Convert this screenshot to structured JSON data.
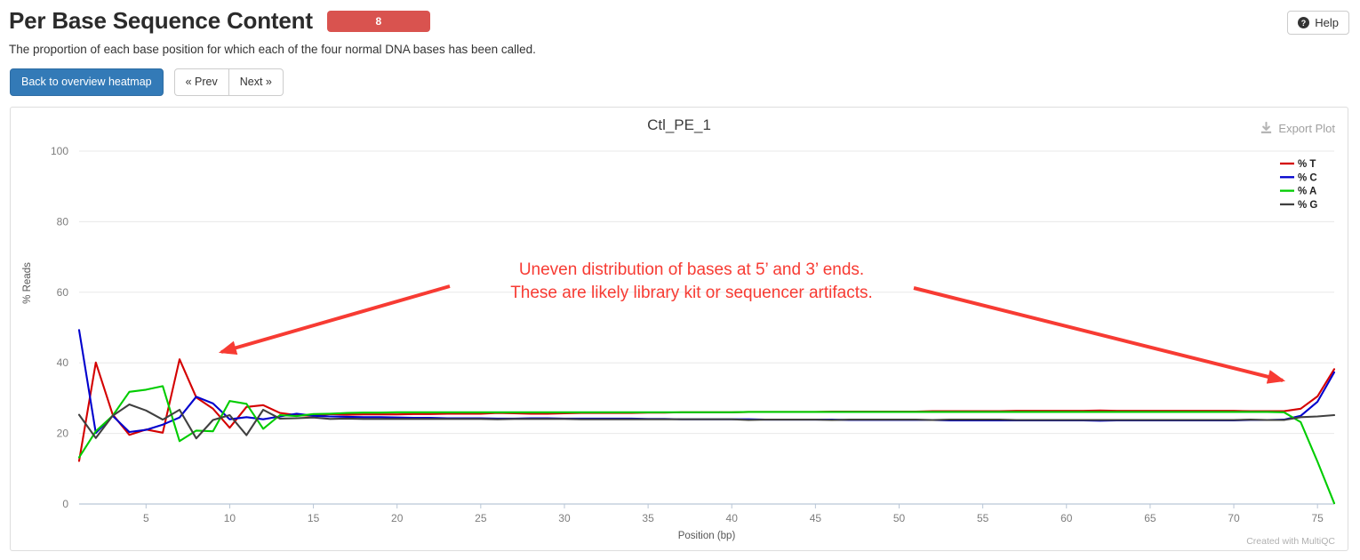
{
  "header": {
    "title": "Per Base Sequence Content",
    "badge": "8",
    "help_label": "Help",
    "help_icon": "question-circle-icon",
    "description": "The proportion of each base position for which each of the four normal DNA bases has been called."
  },
  "toolbar": {
    "back_label": "Back to overview heatmap",
    "prev_label": "« Prev",
    "next_label": "Next »"
  },
  "plot": {
    "title": "Ctl_PE_1",
    "export_label": "Export Plot",
    "export_icon": "download-icon",
    "credit": "Created with MultiQC"
  },
  "annotation": {
    "line1": "Uneven distribution of bases at 5’ and 3’ ends.",
    "line2": "These are likely library kit or sequencer artifacts.",
    "color": "#f73b33"
  },
  "chart_data": {
    "type": "line",
    "title": "Ctl_PE_1",
    "xlabel": "Position (bp)",
    "ylabel": "% Reads",
    "xlim": [
      1,
      76
    ],
    "ylim": [
      0,
      100
    ],
    "xticks": [
      5,
      10,
      15,
      20,
      25,
      30,
      35,
      40,
      45,
      50,
      55,
      60,
      65,
      70,
      75
    ],
    "yticks": [
      0,
      20,
      40,
      60,
      80,
      100
    ],
    "grid": true,
    "legend_position": "top-right",
    "x": [
      1,
      2,
      3,
      4,
      5,
      6,
      7,
      8,
      9,
      10,
      11,
      12,
      13,
      14,
      15,
      16,
      17,
      18,
      19,
      20,
      21,
      22,
      23,
      24,
      25,
      26,
      27,
      28,
      29,
      30,
      31,
      32,
      33,
      34,
      35,
      36,
      37,
      38,
      39,
      40,
      41,
      42,
      43,
      44,
      45,
      46,
      47,
      48,
      49,
      50,
      51,
      52,
      53,
      54,
      55,
      56,
      57,
      58,
      59,
      60,
      61,
      62,
      63,
      64,
      65,
      66,
      67,
      68,
      69,
      70,
      71,
      72,
      73,
      74,
      75,
      76
    ],
    "series": [
      {
        "name": "% T",
        "color": "#d40000",
        "values": [
          12.2,
          40.1,
          25.4,
          19.6,
          21.1,
          20.2,
          41.0,
          30.2,
          27.0,
          21.6,
          27.5,
          28.0,
          25.8,
          25.2,
          25.0,
          25.5,
          25.3,
          25.4,
          25.4,
          25.4,
          25.5,
          25.5,
          25.6,
          25.6,
          25.6,
          25.8,
          25.7,
          25.6,
          25.6,
          25.7,
          25.8,
          25.8,
          25.8,
          25.8,
          25.9,
          25.9,
          26.0,
          26.0,
          26.0,
          26.0,
          26.1,
          26.1,
          26.1,
          26.1,
          26.1,
          26.2,
          26.2,
          26.2,
          26.2,
          26.2,
          26.2,
          26.3,
          26.3,
          26.3,
          26.3,
          26.3,
          26.4,
          26.4,
          26.4,
          26.4,
          26.4,
          26.5,
          26.4,
          26.4,
          26.4,
          26.4,
          26.4,
          26.4,
          26.4,
          26.4,
          26.3,
          26.3,
          26.3,
          27.0,
          30.5,
          38.2
        ]
      },
      {
        "name": "% C",
        "color": "#0000cd",
        "values": [
          49.3,
          20.1,
          25.0,
          20.4,
          21.0,
          22.5,
          24.5,
          30.4,
          28.5,
          24.0,
          24.6,
          24.0,
          24.8,
          25.6,
          25.0,
          24.8,
          24.7,
          24.6,
          24.6,
          24.5,
          24.4,
          24.4,
          24.3,
          24.3,
          24.3,
          24.2,
          24.2,
          24.3,
          24.3,
          24.2,
          24.2,
          24.2,
          24.2,
          24.2,
          24.1,
          24.1,
          24.0,
          24.0,
          24.0,
          24.0,
          24.0,
          23.9,
          23.9,
          23.9,
          23.9,
          23.9,
          23.8,
          23.8,
          23.8,
          23.8,
          23.8,
          23.8,
          23.7,
          23.7,
          23.7,
          23.7,
          23.7,
          23.7,
          23.7,
          23.7,
          23.7,
          23.6,
          23.7,
          23.7,
          23.7,
          23.7,
          23.7,
          23.7,
          23.7,
          23.7,
          23.8,
          23.8,
          23.9,
          25.0,
          29.0,
          37.3
        ]
      },
      {
        "name": "% A",
        "color": "#00cc00",
        "values": [
          13.2,
          20.6,
          25.0,
          31.8,
          32.4,
          33.4,
          17.8,
          20.8,
          20.6,
          29.2,
          28.4,
          21.3,
          25.2,
          24.9,
          25.5,
          25.6,
          25.8,
          25.9,
          25.9,
          26.0,
          26.0,
          26.0,
          26.0,
          26.0,
          26.0,
          26.0,
          26.0,
          26.0,
          26.0,
          26.0,
          26.0,
          26.0,
          26.0,
          26.0,
          26.0,
          26.0,
          26.0,
          26.0,
          26.0,
          26.0,
          26.1,
          26.1,
          26.1,
          26.1,
          26.1,
          26.1,
          26.1,
          26.1,
          26.1,
          26.1,
          26.1,
          26.1,
          26.1,
          26.1,
          26.1,
          26.1,
          26.1,
          26.1,
          26.1,
          26.1,
          26.1,
          26.1,
          26.1,
          26.1,
          26.1,
          26.1,
          26.1,
          26.1,
          26.1,
          26.1,
          26.1,
          26.1,
          26.0,
          23.2,
          12.0,
          0.2
        ]
      },
      {
        "name": "% G",
        "color": "#404040",
        "values": [
          25.3,
          18.7,
          25.0,
          28.2,
          26.5,
          23.9,
          26.7,
          18.6,
          23.8,
          25.2,
          19.5,
          26.7,
          24.2,
          24.3,
          24.5,
          24.1,
          24.2,
          24.1,
          24.1,
          24.1,
          24.1,
          24.1,
          24.1,
          24.1,
          24.1,
          24.0,
          24.1,
          24.1,
          24.1,
          24.1,
          24.0,
          24.0,
          24.0,
          24.0,
          24.0,
          24.0,
          24.0,
          24.0,
          24.0,
          24.0,
          23.8,
          23.9,
          23.9,
          23.9,
          23.9,
          23.8,
          23.9,
          23.9,
          23.9,
          23.9,
          23.9,
          23.8,
          23.9,
          23.9,
          23.9,
          23.9,
          23.8,
          23.8,
          23.8,
          23.8,
          23.8,
          23.8,
          23.8,
          23.8,
          23.8,
          23.8,
          23.8,
          23.8,
          23.8,
          23.8,
          23.9,
          23.8,
          23.8,
          24.6,
          24.8,
          25.2
        ]
      }
    ]
  }
}
